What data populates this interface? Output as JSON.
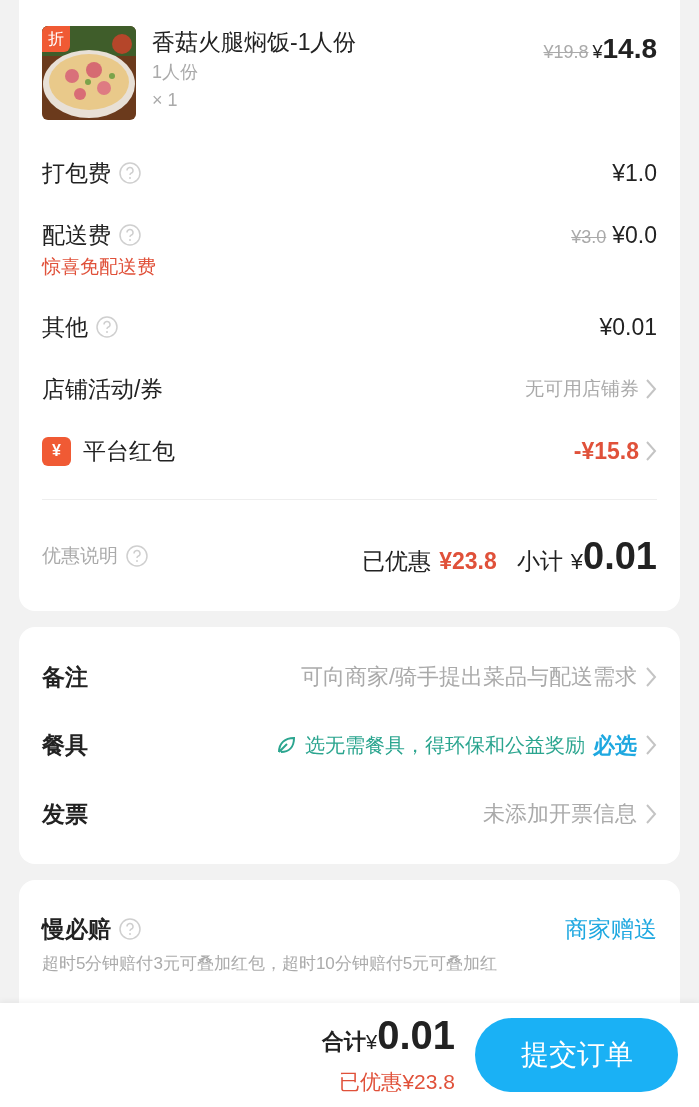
{
  "order_item": {
    "badge": "折",
    "name": "香菇火腿焖饭-1人份",
    "spec": "1人份",
    "qty": "× 1",
    "original_price": "¥19.8",
    "currency": "¥",
    "price": "14.8"
  },
  "rows": [
    {
      "kind": "fee",
      "label": "打包费",
      "help": true,
      "price": "¥1.0"
    },
    {
      "kind": "fee",
      "label": "配送费",
      "help": true,
      "original_price": "¥3.0",
      "price": "¥0.0",
      "note": "惊喜免配送费"
    },
    {
      "kind": "fee",
      "label": "其他",
      "help": true,
      "price": "¥0.01"
    },
    {
      "kind": "link",
      "label": "店铺活动/券",
      "value": "无可用店铺券"
    },
    {
      "kind": "redpacket",
      "icon_text": "¥",
      "label": "平台红包",
      "value": "-¥15.8"
    }
  ],
  "summary": {
    "label": "优惠说明",
    "discount_label": "已优惠",
    "discount": "¥23.8",
    "subtotal_label": "小计",
    "subtotal_currency": "¥",
    "subtotal": "0.01"
  },
  "extras": [
    {
      "kind": "plain",
      "label": "备注",
      "value": "可向商家/骑手提出菜品与配送需求"
    },
    {
      "kind": "eco",
      "label": "餐具",
      "value": "选无需餐具，得环保和公益奖励",
      "emphasis": "必选"
    },
    {
      "kind": "plain",
      "label": "发票",
      "value": "未添加开票信息"
    }
  ],
  "guarantee": {
    "title": "慢必赔",
    "help": true,
    "action": "商家赠送",
    "description": "超时5分钟赔付3元可叠加红包，超时10分钟赔付5元可叠加红"
  },
  "footer": {
    "total_label": "合计",
    "currency": "¥",
    "total": "0.01",
    "discount": "已优惠¥23.8",
    "submit": "提交订单"
  }
}
